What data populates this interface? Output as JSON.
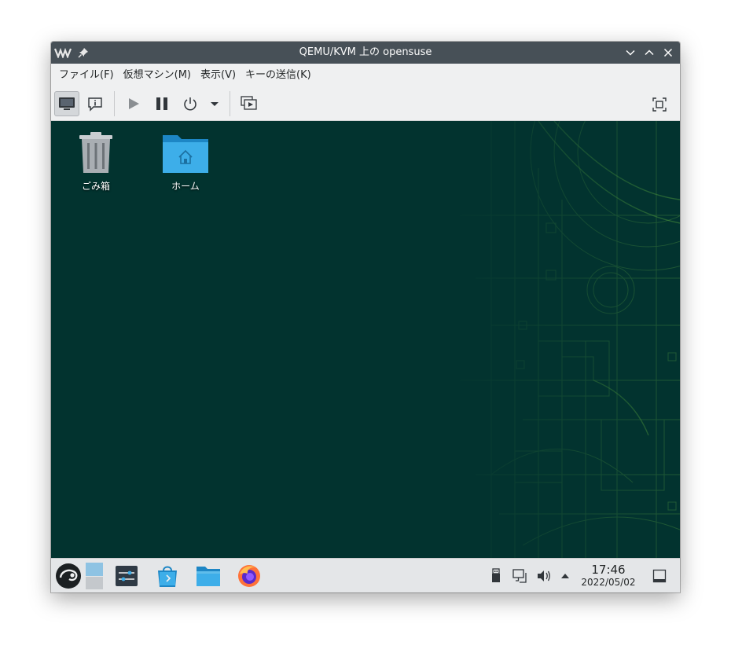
{
  "window": {
    "title": "QEMU/KVM 上の opensuse",
    "app_icon": "virt-manager-icon",
    "controls": [
      "minimize-icon",
      "maximize-icon",
      "close-icon"
    ]
  },
  "menu": {
    "items": [
      {
        "label": "ファイル(F)"
      },
      {
        "label": "仮想マシン(M)"
      },
      {
        "label": "表示(V)"
      },
      {
        "label": "キーの送信(K)"
      }
    ]
  },
  "toolbar": {
    "buttons": [
      "console-icon",
      "details-icon",
      "run-icon",
      "pause-icon",
      "power-icon",
      "dropdown-icon",
      "snapshots-icon",
      "fullscreen-icon"
    ]
  },
  "desktop": {
    "icons": [
      {
        "label": "ごみ箱",
        "icon": "trash-icon"
      },
      {
        "label": "ホーム",
        "icon": "home-folder-icon"
      }
    ],
    "background": "#02332f",
    "accent": "#3a7a3a"
  },
  "taskbar": {
    "launchers": [
      "opensuse-menu-icon",
      "pager-icon",
      "system-settings-icon",
      "discover-store-icon",
      "file-manager-icon",
      "firefox-icon"
    ],
    "tray": [
      "usb-device-icon",
      "network-icon",
      "volume-icon",
      "tray-expand-icon"
    ],
    "clock": {
      "time": "17:46",
      "date": "2022/05/02"
    },
    "show_desktop": "show-desktop-icon"
  }
}
